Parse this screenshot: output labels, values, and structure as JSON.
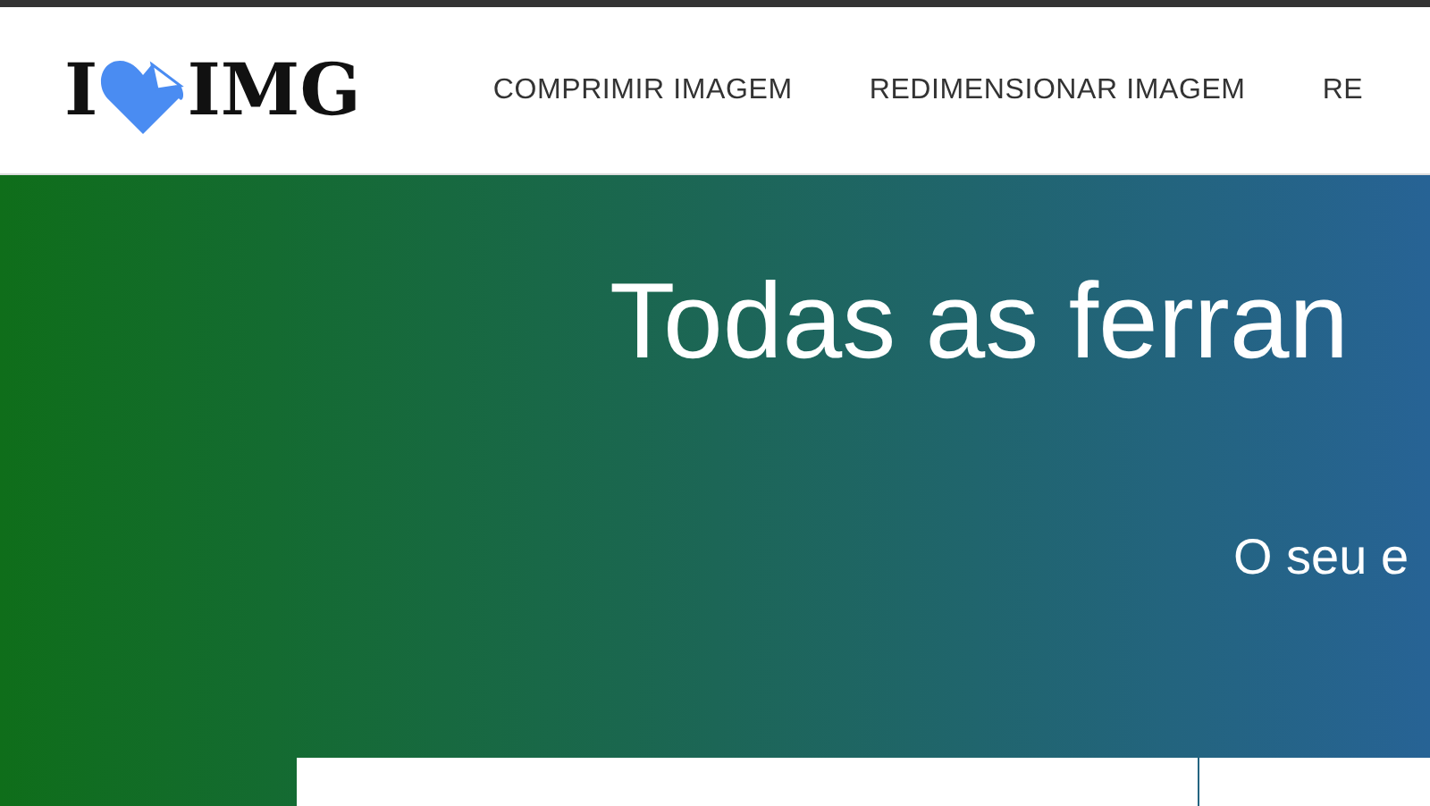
{
  "header": {
    "logo": {
      "left": "I",
      "right": "IMG"
    },
    "nav": [
      {
        "label": "COMPRIMIR IMAGEM"
      },
      {
        "label": "REDIMENSIONAR IMAGEM"
      },
      {
        "label": "RE"
      }
    ]
  },
  "hero": {
    "title": "Todas as ferran",
    "subtitle": "O seu e"
  }
}
